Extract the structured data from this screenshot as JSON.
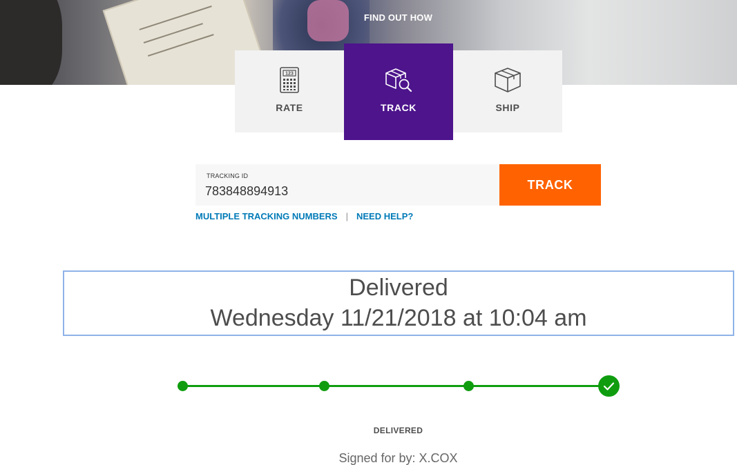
{
  "hero": {
    "cta": "FIND OUT HOW"
  },
  "tabs": [
    {
      "label": "RATE",
      "icon": "calculator-icon",
      "active": false
    },
    {
      "label": "TRACK",
      "icon": "box-search-icon",
      "active": true
    },
    {
      "label": "SHIP",
      "icon": "box-icon",
      "active": false
    }
  ],
  "form": {
    "field_label": "TRACKING ID",
    "tracking_id": "783848894913",
    "button_label": "TRACK",
    "link_multiple": "MULTIPLE TRACKING NUMBERS",
    "separator": "|",
    "link_help": "NEED HELP?"
  },
  "status": {
    "headline": "Delivered",
    "datetime": "Wednesday 11/21/2018 at 10:04 am"
  },
  "progress": {
    "steps_total": 4,
    "steps_completed": 4,
    "current_label": "DELIVERED",
    "signed": "Signed for by: X.COX"
  },
  "colors": {
    "brand_purple": "#4d148c",
    "brand_orange": "#ff6200",
    "link_blue": "#007ab7",
    "progress_green": "#0f9d0f"
  }
}
